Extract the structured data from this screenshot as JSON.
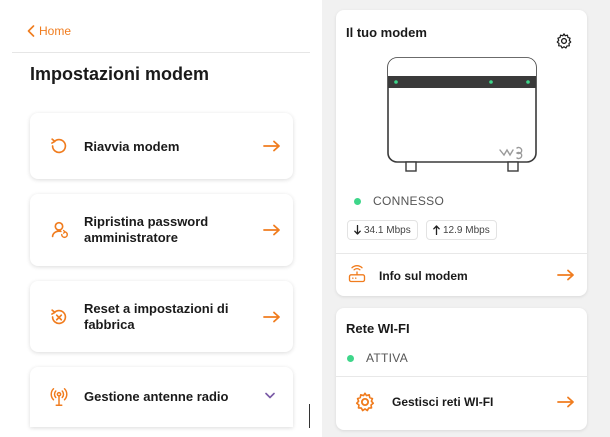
{
  "nav": {
    "back_label": "Home"
  },
  "page": {
    "title": "Impostazioni modem"
  },
  "actions": [
    {
      "label": "Riavvia modem",
      "icon": "restart-icon"
    },
    {
      "label": "Ripristina password amministratore",
      "icon": "user-reset-icon"
    },
    {
      "label": "Reset a impostazioni di fabbrica",
      "icon": "factory-reset-icon"
    },
    {
      "label": "Gestione antenne radio",
      "icon": "antenna-icon"
    }
  ],
  "modem": {
    "title": "Il tuo modem",
    "status": "CONNESSO",
    "download": "34.1 Mbps",
    "upload": "12.9 Mbps",
    "info_label": "Info sul modem"
  },
  "wifi": {
    "title": "Rete WI-FI",
    "status": "ATTIVA",
    "manage_label": "Gestisci reti WI-FI"
  },
  "colors": {
    "accent": "#f07c1e",
    "status_ok": "#3ed68a"
  }
}
